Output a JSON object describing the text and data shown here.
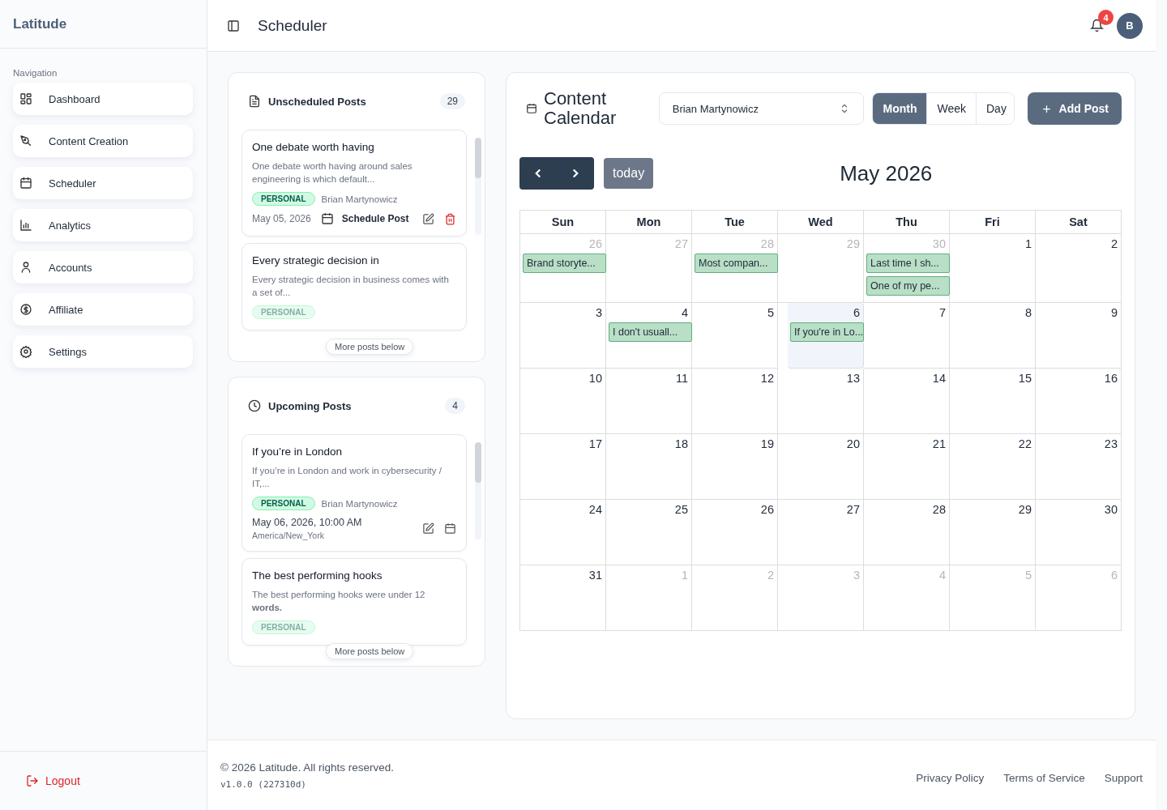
{
  "sidebar": {
    "logo": "Latitude",
    "section_label": "Navigation",
    "items": [
      {
        "label": "Dashboard"
      },
      {
        "label": "Content Creation"
      },
      {
        "label": "Scheduler"
      },
      {
        "label": "Analytics"
      },
      {
        "label": "Accounts"
      },
      {
        "label": "Affiliate"
      },
      {
        "label": "Settings"
      }
    ],
    "logout": "Logout"
  },
  "header": {
    "title": "Scheduler",
    "notifications": "4",
    "avatar": "B"
  },
  "unscheduled": {
    "title": "Unscheduled Posts",
    "count": "29",
    "more": "More posts below",
    "posts": [
      {
        "title": "One debate worth having",
        "excerpt": "One debate worth having around sales engineering is which default...",
        "tag": "PERSONAL",
        "author": "Brian Martynowicz",
        "date": "May 05, 2026",
        "action": "Schedule Post"
      },
      {
        "title": "Every strategic decision in",
        "excerpt": "Every strategic decision in business comes with a set of...",
        "tag": "PERSONAL"
      }
    ]
  },
  "upcoming": {
    "title": "Upcoming Posts",
    "count": "4",
    "more": "More posts below",
    "posts": [
      {
        "title": "If you’re in London",
        "excerpt": "If you’re in London and work in cybersecurity / IT,...",
        "tag": "PERSONAL",
        "author": "Brian Martynowicz",
        "datetime": "May 06, 2026, 10:00 AM",
        "timezone": "America/New_York"
      },
      {
        "title": "The best performing hooks",
        "excerpt": "The best performing hooks were under 12 **words.**",
        "tag": "PERSONAL"
      }
    ]
  },
  "calendar": {
    "title": "Content Calendar",
    "account": "Brian Martynowicz",
    "views": [
      {
        "label": "Month",
        "selected": true
      },
      {
        "label": "Week",
        "selected": false
      },
      {
        "label": "Day",
        "selected": false
      }
    ],
    "add": "Add Post",
    "today": "today",
    "month": "May 2026",
    "weekdays": [
      "Sun",
      "Mon",
      "Tue",
      "Wed",
      "Thu",
      "Fri",
      "Sat"
    ],
    "weeks": [
      [
        {
          "day": "26",
          "muted": true,
          "today": false,
          "events": [
            "Brand storyte..."
          ]
        },
        {
          "day": "27",
          "muted": true,
          "today": false
        },
        {
          "day": "28",
          "muted": true,
          "today": false,
          "events": [
            "Most compan..."
          ]
        },
        {
          "day": "29",
          "muted": true,
          "today": false
        },
        {
          "day": "30",
          "muted": true,
          "today": false,
          "events": [
            "Last time I sh...",
            "One of my pe..."
          ]
        },
        {
          "day": "1",
          "muted": false,
          "today": false
        },
        {
          "day": "2",
          "muted": false,
          "today": false
        }
      ],
      [
        {
          "day": "3",
          "muted": false,
          "today": false
        },
        {
          "day": "4",
          "muted": false,
          "today": false,
          "events": [
            "I don't usuall..."
          ]
        },
        {
          "day": "5",
          "muted": false,
          "today": false
        },
        {
          "day": "6",
          "muted": false,
          "today": true,
          "events": [
            "If you're in Lo..."
          ]
        },
        {
          "day": "7",
          "muted": false,
          "today": false
        },
        {
          "day": "8",
          "muted": false,
          "today": false
        },
        {
          "day": "9",
          "muted": false,
          "today": false
        }
      ],
      [
        {
          "day": "10",
          "muted": false,
          "today": false
        },
        {
          "day": "11",
          "muted": false,
          "today": false
        },
        {
          "day": "12",
          "muted": false,
          "today": false
        },
        {
          "day": "13",
          "muted": false,
          "today": false
        },
        {
          "day": "14",
          "muted": false,
          "today": false
        },
        {
          "day": "15",
          "muted": false,
          "today": false
        },
        {
          "day": "16",
          "muted": false,
          "today": false
        }
      ],
      [
        {
          "day": "17",
          "muted": false,
          "today": false
        },
        {
          "day": "18",
          "muted": false,
          "today": false
        },
        {
          "day": "19",
          "muted": false,
          "today": false
        },
        {
          "day": "20",
          "muted": false,
          "today": false
        },
        {
          "day": "21",
          "muted": false,
          "today": false
        },
        {
          "day": "22",
          "muted": false,
          "today": false
        },
        {
          "day": "23",
          "muted": false,
          "today": false
        }
      ],
      [
        {
          "day": "24",
          "muted": false,
          "today": false
        },
        {
          "day": "25",
          "muted": false,
          "today": false
        },
        {
          "day": "26",
          "muted": false,
          "today": false
        },
        {
          "day": "27",
          "muted": false,
          "today": false
        },
        {
          "day": "28",
          "muted": false,
          "today": false
        },
        {
          "day": "29",
          "muted": false,
          "today": false
        },
        {
          "day": "30",
          "muted": false,
          "today": false
        }
      ],
      [
        {
          "day": "31",
          "muted": false,
          "today": false
        },
        {
          "day": "1",
          "muted": true,
          "today": false
        },
        {
          "day": "2",
          "muted": true,
          "today": false
        },
        {
          "day": "3",
          "muted": true,
          "today": false
        },
        {
          "day": "4",
          "muted": true,
          "today": false
        },
        {
          "day": "5",
          "muted": true,
          "today": false
        },
        {
          "day": "6",
          "muted": true,
          "today": false
        }
      ]
    ]
  },
  "footer": {
    "copyright": "© 2026 Latitude. All rights reserved.",
    "version": "v1.0.0 (227310d)",
    "links": [
      "Privacy Policy",
      "Terms of Service",
      "Support"
    ]
  }
}
